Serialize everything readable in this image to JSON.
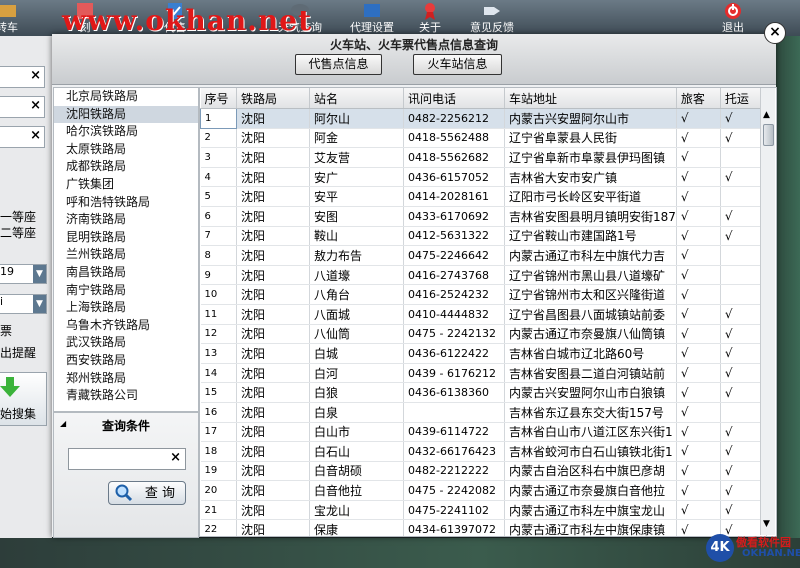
{
  "watermark": "www.okhan.net",
  "toolbar": {
    "items": [
      {
        "label": "转车"
      },
      {
        "label": "刻"
      },
      {
        "label": "代售"
      },
      {
        "label": "天气查询"
      },
      {
        "label": "代理设置"
      },
      {
        "label": "关于"
      },
      {
        "label": "意见反馈"
      },
      {
        "label": "退出"
      }
    ]
  },
  "background_left": {
    "seat_first": "一等座",
    "seat_second": "二等座",
    "select_value": "19",
    "ticket": "票",
    "remind": "出提醒",
    "search": "始搜集"
  },
  "dialog": {
    "title": "火车站、火车票代售点信息查询",
    "tab_agency": "代售点信息",
    "tab_station": "火车站信息",
    "close": "×"
  },
  "bureaus": [
    "北京局铁路局",
    "沈阳铁路局",
    "哈尔滨铁路局",
    "太原铁路局",
    "成都铁路局",
    "广铁集团",
    "呼和浩特铁路局",
    "济南铁路局",
    "昆明铁路局",
    "兰州铁路局",
    "南昌铁路局",
    "南宁铁路局",
    "上海铁路局",
    "乌鲁木齐铁路局",
    "武汉铁路局",
    "西安铁路局",
    "郑州铁路局",
    "青藏铁路公司"
  ],
  "query": {
    "title": "查询条件",
    "clear": "×",
    "button_label": "查 询"
  },
  "table": {
    "headers": [
      "序号",
      "铁路局",
      "站名",
      "讯问电话",
      "车站地址",
      "旅客",
      "托运"
    ],
    "rows": [
      [
        "1",
        "沈阳",
        "阿尔山",
        "0482-2256212",
        "内蒙古兴安盟阿尔山市",
        "√",
        "√"
      ],
      [
        "2",
        "沈阳",
        "阿金",
        "0418-5562488",
        "辽宁省阜蒙县人民街",
        "√",
        "√"
      ],
      [
        "3",
        "沈阳",
        "艾友营",
        "0418-5562682",
        "辽宁省阜新市阜蒙县伊玛图镇",
        "√",
        ""
      ],
      [
        "4",
        "沈阳",
        "安广",
        "0436-6157052",
        "吉林省大安市安广镇",
        "√",
        "√"
      ],
      [
        "5",
        "沈阳",
        "安平",
        "0414-2028161",
        "辽阳市弓长岭区安平街道",
        "√",
        ""
      ],
      [
        "6",
        "沈阳",
        "安图",
        "0433-6170692",
        "吉林省安图县明月镇明安街187",
        "√",
        "√"
      ],
      [
        "7",
        "沈阳",
        "鞍山",
        "0412-5631322",
        "辽宁省鞍山市建国路1号",
        "√",
        "√"
      ],
      [
        "8",
        "沈阳",
        "敖力布告",
        "0475-2246642",
        "内蒙古通辽市科左中旗代力吉",
        "√",
        ""
      ],
      [
        "9",
        "沈阳",
        "八道壕",
        "0416-2743768",
        "辽宁省锦州市黑山县八道壕矿",
        "√",
        ""
      ],
      [
        "10",
        "沈阳",
        "八角台",
        "0416-2524232",
        "辽宁省锦州市太和区兴隆街道",
        "√",
        ""
      ],
      [
        "11",
        "沈阳",
        "八面城",
        "0410-4444832",
        "辽宁省昌图县八面城镇站前委",
        "√",
        "√"
      ],
      [
        "12",
        "沈阳",
        "八仙筒",
        "0475 - 2242132",
        "内蒙古通辽市奈曼旗八仙筒镇",
        "√",
        "√"
      ],
      [
        "13",
        "沈阳",
        "白城",
        "0436-6122422",
        "吉林省白城市辽北路60号",
        "√",
        "√"
      ],
      [
        "14",
        "沈阳",
        "白河",
        "0439 - 6176212",
        "吉林省安图县二道白河镇站前",
        "√",
        "√"
      ],
      [
        "15",
        "沈阳",
        "白狼",
        "0436-6138360",
        "内蒙古兴安盟阿尔山市白狼镇",
        "√",
        "√"
      ],
      [
        "16",
        "沈阳",
        "白泉",
        "",
        "吉林省东辽县东交大街157号",
        "√",
        ""
      ],
      [
        "17",
        "沈阳",
        "白山市",
        "0439-6114722",
        "吉林省白山市八道江区东兴街1",
        "√",
        "√"
      ],
      [
        "18",
        "沈阳",
        "白石山",
        "0432-66176423",
        "吉林省蛟河市白石山镇铁北街1",
        "√",
        "√"
      ],
      [
        "19",
        "沈阳",
        "白音胡硕",
        "0482-2212222",
        "内蒙古自治区科右中旗巴彦胡",
        "√",
        "√"
      ],
      [
        "20",
        "沈阳",
        "白音他拉",
        "0475 - 2242082",
        "内蒙古通辽市奈曼旗白音他拉",
        "√",
        "√"
      ],
      [
        "21",
        "沈阳",
        "宝龙山",
        "0475-2241102",
        "内蒙古通辽市科左中旗宝龙山",
        "√",
        "√"
      ],
      [
        "22",
        "沈阳",
        "保康",
        "0434-61397072",
        "内蒙古通辽市科左中旗保康镇",
        "√",
        "√"
      ]
    ]
  },
  "logo": {
    "mark": "4K",
    "text1": "傲看软件园",
    "text2": "OKHAN.NET"
  },
  "colors": {
    "selected_row": "#d6e0ea",
    "watermark": "#e01818"
  }
}
